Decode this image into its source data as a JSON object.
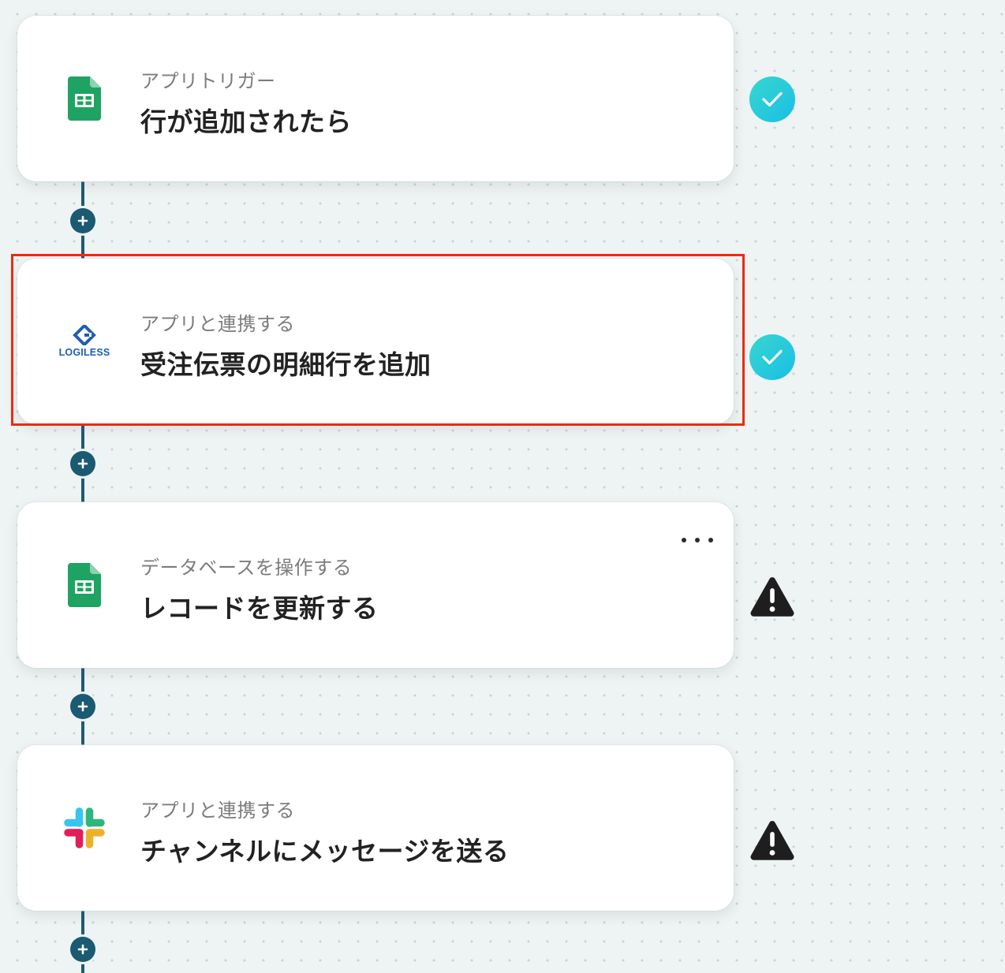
{
  "steps": [
    {
      "subtitle": "アプリトリガー",
      "title": "行が追加されたら",
      "app_icon": "google-sheets-icon",
      "status": "completed"
    },
    {
      "subtitle": "アプリと連携する",
      "title": "受注伝票の明細行を追加",
      "app_icon": "logiless-logo",
      "logo_text": "LOGILESS",
      "status": "completed",
      "highlighted": true
    },
    {
      "subtitle": "データベースを操作する",
      "title": "レコードを更新する",
      "app_icon": "google-sheets-icon",
      "status": "warning"
    },
    {
      "subtitle": "アプリと連携する",
      "title": "チャンネルにメッセージを送る",
      "app_icon": "slack-icon",
      "status": "warning"
    }
  ],
  "colors": {
    "connector": "#1f5b73",
    "check_gradient_start": "#38d6cf",
    "check_gradient_end": "#19bfe6",
    "highlight_border": "#ee2a12",
    "warning": "#1e1e1e"
  }
}
